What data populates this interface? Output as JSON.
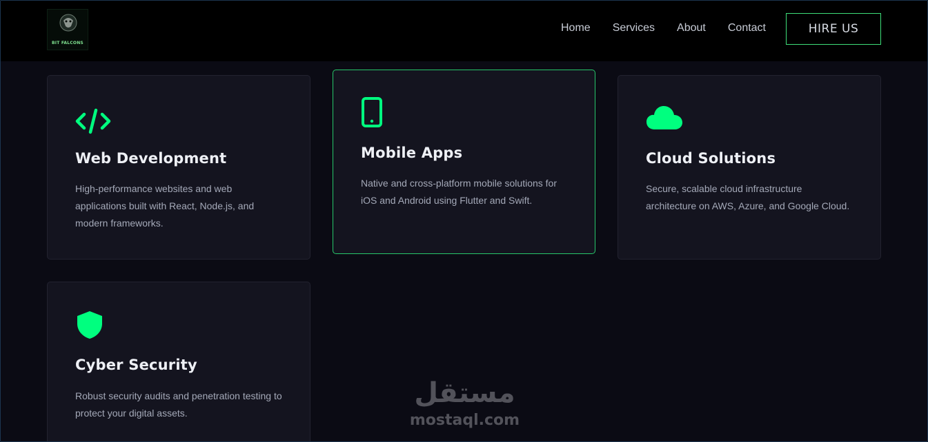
{
  "header": {
    "logo_text": "BIT FALCONS",
    "nav": [
      {
        "label": "Home"
      },
      {
        "label": "Services"
      },
      {
        "label": "About"
      },
      {
        "label": "Contact"
      }
    ],
    "cta_label": "HIRE US"
  },
  "services": [
    {
      "icon": "code-icon",
      "title": "Web Development",
      "description": "High-performance websites and web applications built with React, Node.js, and modern frameworks."
    },
    {
      "icon": "mobile-phone-icon",
      "title": "Mobile Apps",
      "description": "Native and cross-platform mobile solutions for iOS and Android using Flutter and Swift."
    },
    {
      "icon": "cloud-icon",
      "title": "Cloud Solutions",
      "description": "Secure, scalable cloud infrastructure architecture on AWS, Azure, and Google Cloud."
    },
    {
      "icon": "shield-icon",
      "title": "Cyber Security",
      "description": "Robust security audits and penetration testing to protect your digital assets."
    }
  ],
  "watermark": {
    "arabic": "مستقل",
    "latin": "mostaql.com"
  },
  "colors": {
    "accent": "#00ff7f",
    "card_bg": "#14141f",
    "page_bg": "#0b0b14",
    "nav_bg": "#000000",
    "active_border": "#27c86a"
  }
}
